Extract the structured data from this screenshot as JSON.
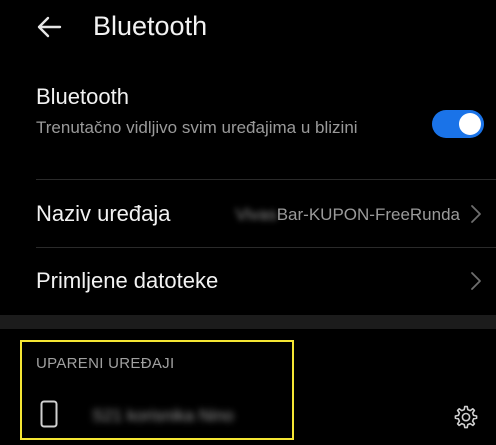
{
  "header": {
    "title": "Bluetooth",
    "back_icon": "arrow-left-icon"
  },
  "bluetooth": {
    "label": "Bluetooth",
    "description": "Trenutačno vidljivo svim uređajima u blizini",
    "enabled": true,
    "toggle_color": "#1a73e8"
  },
  "device_name": {
    "label": "Naziv uređaja",
    "value_prefix": "Vivas",
    "value": "Bar-KUPON-FreeRunda"
  },
  "received_files": {
    "label": "Primljene datoteke"
  },
  "paired_devices": {
    "header": "UPARENI UREĐAJI",
    "highlight_color": "#f5e634",
    "items": [
      {
        "name": "S21 korisnika Nino",
        "icon": "phone-icon",
        "settings_icon": "gear-icon"
      }
    ]
  }
}
